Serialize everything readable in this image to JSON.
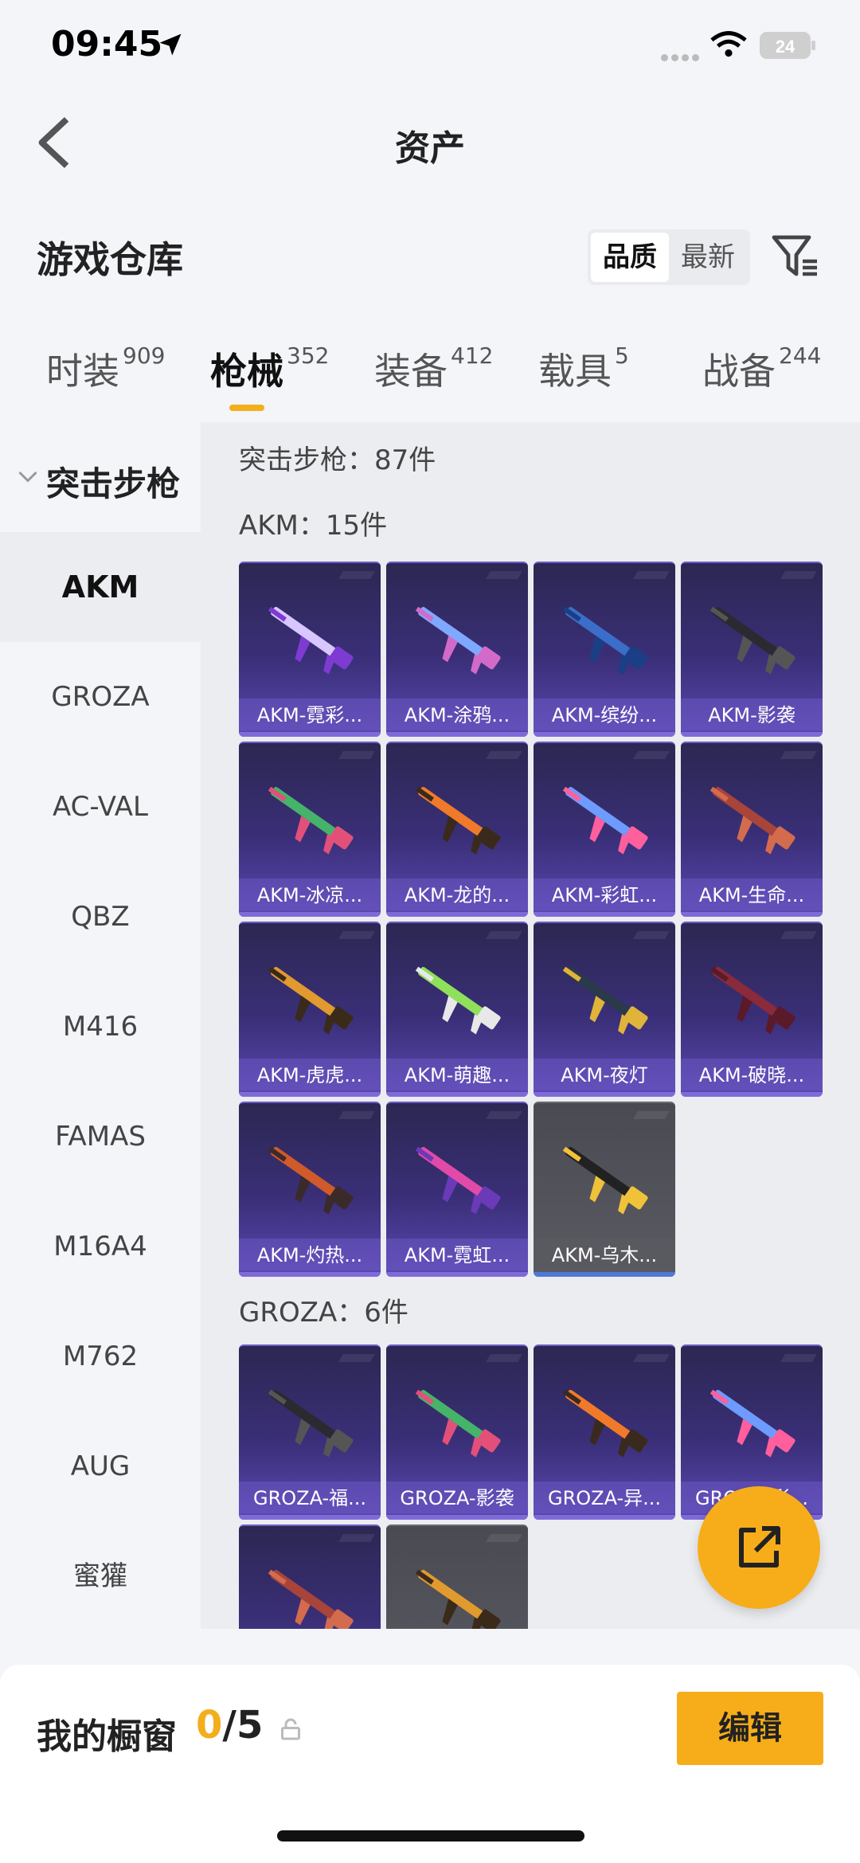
{
  "status_bar": {
    "time": "09:45",
    "battery": "24"
  },
  "nav": {
    "title": "资产"
  },
  "header": {
    "section_title": "游戏仓库",
    "sort_options": [
      "品质",
      "最新"
    ],
    "sort_selected": "品质"
  },
  "tabs": [
    {
      "label": "时装",
      "count": "909"
    },
    {
      "label": "枪械",
      "count": "352",
      "active": true
    },
    {
      "label": "装备",
      "count": "412"
    },
    {
      "label": "载具",
      "count": "5"
    },
    {
      "label": "战备",
      "count": "244"
    }
  ],
  "sidebar": {
    "group_label": "突击步枪",
    "items": [
      "AKM",
      "GROZA",
      "AC-VAL",
      "QBZ",
      "M416",
      "FAMAS",
      "M16A4",
      "M762",
      "AUG",
      "蜜獾"
    ],
    "active_item": "AKM"
  },
  "content": {
    "category_summary": "突击步枪：87件",
    "akm_header": "AKM：15件",
    "akm_items": [
      "AKM-霓彩...",
      "AKM-涂鸦...",
      "AKM-缤纷...",
      "AKM-影袭",
      "AKM-冰凉...",
      "AKM-龙的...",
      "AKM-彩虹...",
      "AKM-生命...",
      "AKM-虎虎...",
      "AKM-萌趣...",
      "AKM-夜灯",
      "AKM-破晓...",
      "AKM-灼热...",
      "AKM-霓虹...",
      "AKM-乌木..."
    ],
    "groza_header": "GROZA：6件",
    "groza_items": [
      "GROZA-福...",
      "GROZA-影袭",
      "GROZA-异...",
      "GROZA-彩...",
      "",
      ""
    ]
  },
  "colors": {
    "accent": "#f7ad1a",
    "card_purple": "#3a2f78",
    "card_grey": "#55555c"
  },
  "bottom_bar": {
    "label": "我的橱窗",
    "current": "0",
    "total": "/5",
    "edit_label": "编辑"
  }
}
